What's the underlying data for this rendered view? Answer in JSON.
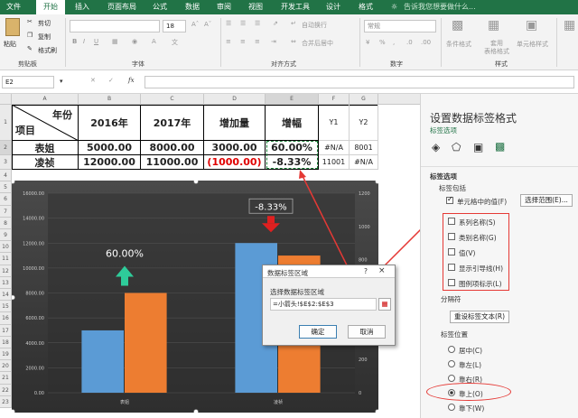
{
  "tabs": [
    "文件",
    "开始",
    "插入",
    "页面布局",
    "公式",
    "数据",
    "审阅",
    "视图",
    "开发工具",
    "设计",
    "格式"
  ],
  "tell_me": "告诉我您想要做什么...",
  "ribbon": {
    "paste": "粘贴",
    "cut": "剪切",
    "copy": "复制",
    "format_painter": "格式刷",
    "clipboard": "剪贴板",
    "font_size": "18",
    "font_group": "字体",
    "wrap_text": "自动换行",
    "merge_center": "合并后居中",
    "align_group": "对齐方式",
    "number_format": "常规",
    "number_group": "数字",
    "cond_format": "条件格式",
    "table_format": "套用\n表格格式",
    "cell_style": "单元格样式",
    "style_group": "样式"
  },
  "formula_bar": {
    "name_box": "E2",
    "fx": "fx"
  },
  "sheet": {
    "columns": [
      "A",
      "B",
      "C",
      "D",
      "E",
      "F",
      "G"
    ],
    "rows": [
      "1",
      "2",
      "3",
      "4",
      "5",
      "6",
      "7",
      "8",
      "9",
      "10",
      "11",
      "12",
      "13",
      "14",
      "15",
      "16",
      "17",
      "18",
      "19",
      "20",
      "21",
      "22",
      "23"
    ],
    "header_year": "年份",
    "header_item": "项目",
    "col_headers": [
      "2016年",
      "2017年",
      "增加量",
      "增幅",
      "Y1",
      "Y2"
    ],
    "row2": [
      "表姐",
      "5000.00",
      "8000.00",
      "3000.00",
      "60.00%",
      "#N/A",
      "8001"
    ],
    "row3": [
      "凌祯",
      "12000.00",
      "11000.00",
      "(1000.00)",
      "-8.33%",
      "11001",
      "#N/A"
    ]
  },
  "chart_data": {
    "type": "bar",
    "categories": [
      "表姐",
      "凌祯"
    ],
    "series": [
      {
        "values": [
          5000,
          12000
        ],
        "color": "#5b9bd5"
      },
      {
        "values": [
          8000,
          11000
        ],
        "color": "#ed7d31"
      }
    ],
    "ylim": [
      0,
      16000
    ],
    "y_ticks": [
      "0.00",
      "2000.00",
      "4000.00",
      "6000.00",
      "8000.00",
      "10000.00",
      "12000.00",
      "14000.00",
      "16000.00"
    ],
    "y2_ticks": [
      "0",
      "200",
      "400",
      "600",
      "800",
      "1000",
      "1200"
    ],
    "labels": [
      "60.00%",
      "-8.33%"
    ],
    "colors": {
      "up_arrow": "#2ecc9a",
      "down_arrow": "#e02020",
      "bg": "#3a3a3a"
    }
  },
  "dialog": {
    "title": "数据标签区域",
    "prompt": "选择数据标签区域",
    "value": "=小箭头!$E$2:$E$3",
    "ok": "确定",
    "cancel": "取消",
    "help": "?",
    "close": "×"
  },
  "pane": {
    "title": "设置数据标签格式",
    "subtitle": "标签选项",
    "section": "标签选项",
    "contains": "标签包括",
    "cell_value": "单元格中的值(F)",
    "select_range": "选择范围(E)...",
    "checks": [
      "系列名称(S)",
      "类别名称(G)",
      "值(V)",
      "显示引导线(H)",
      "图例项标示(L)"
    ],
    "separator": "分隔符",
    "reset": "重设标签文本(R)",
    "position": "标签位置",
    "radios": [
      "居中(C)",
      "靠左(L)",
      "靠右(R)",
      "靠上(O)",
      "靠下(W)"
    ],
    "selected_radio": "靠上(O)"
  }
}
